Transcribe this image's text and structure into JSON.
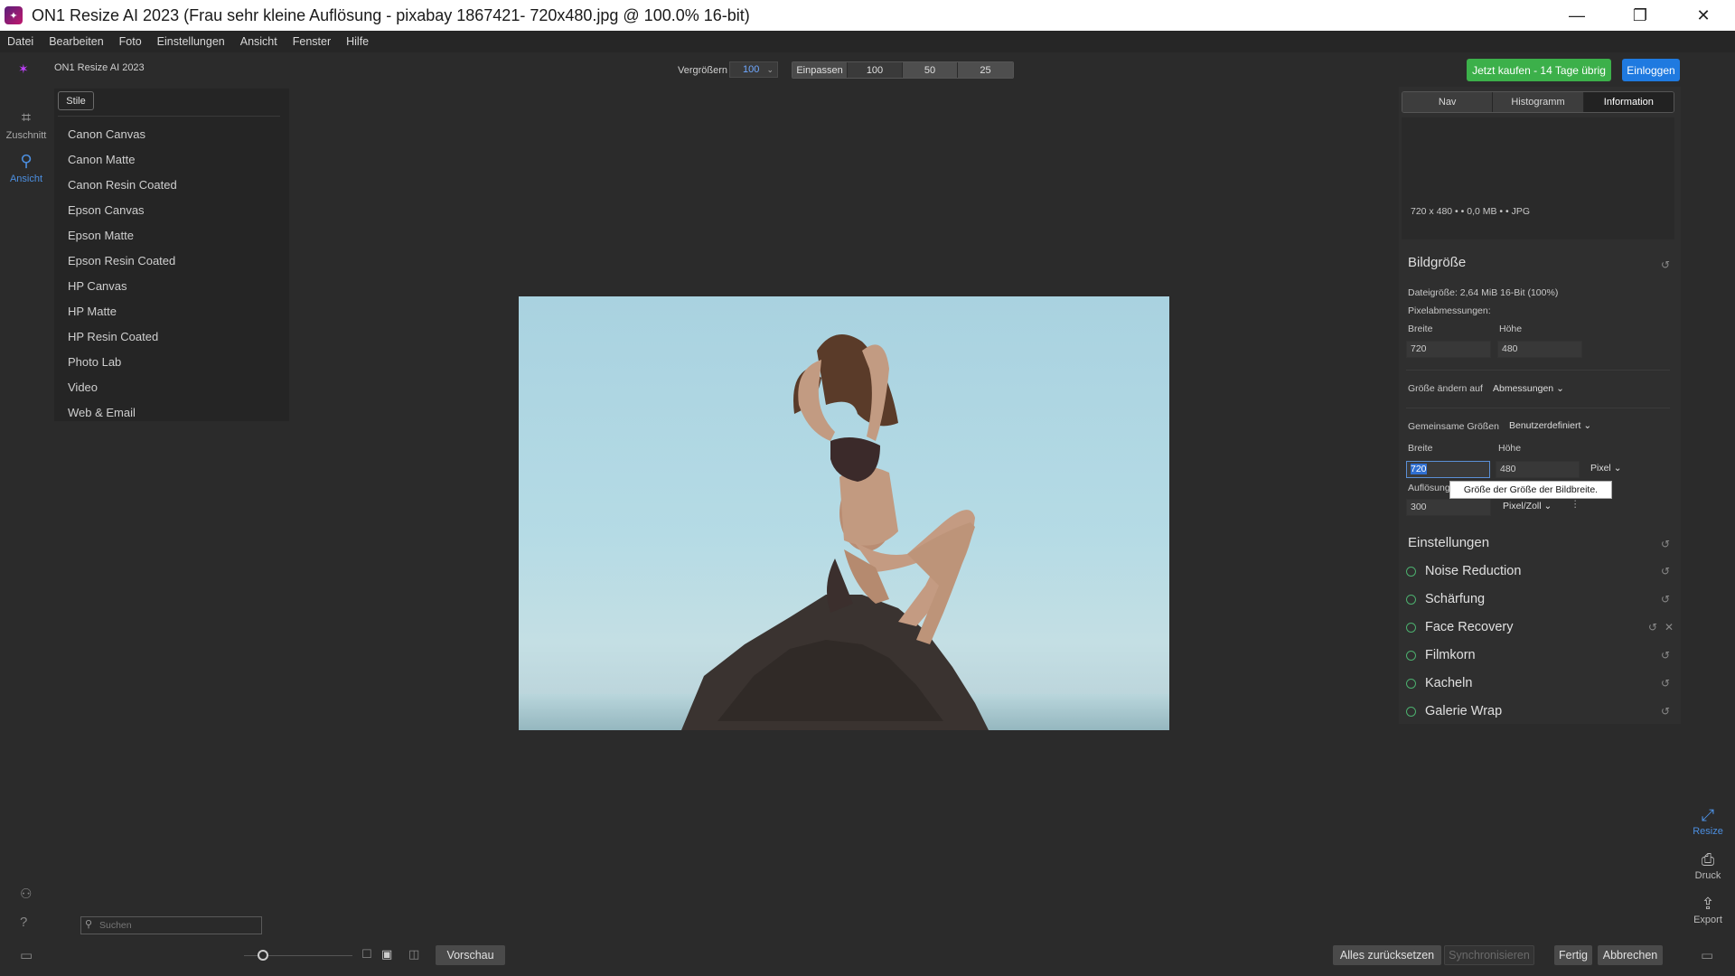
{
  "window": {
    "title": "ON1 Resize AI 2023 (Frau sehr kleine Auflösung - pixabay 1867421- 720x480.jpg @ 100.0% 16-bit)",
    "minimize": "—",
    "maximize": "❐",
    "close": "✕"
  },
  "menu": [
    "Datei",
    "Bearbeiten",
    "Foto",
    "Einstellungen",
    "Ansicht",
    "Fenster",
    "Hilfe"
  ],
  "toolbar": {
    "app_name": "ON1 Resize AI 2023",
    "zoom_label": "Vergrößern",
    "zoom_value": "100",
    "zoom_presets": [
      "Einpassen",
      "100",
      "50",
      "25"
    ],
    "buy_label": "Jetzt kaufen - 14 Tage übrig",
    "login_label": "Einloggen"
  },
  "left_rail": [
    {
      "label": "Zuschnitt",
      "icon": "crop-icon"
    },
    {
      "label": "Ansicht",
      "icon": "view-icon"
    }
  ],
  "styles": {
    "tab_label": "Stile",
    "items": [
      "Canon Canvas",
      "Canon Matte",
      "Canon Resin Coated",
      "Epson Canvas",
      "Epson Matte",
      "Epson Resin Coated",
      "HP Canvas",
      "HP Matte",
      "HP Resin Coated",
      "Photo Lab",
      "Video",
      "Web & Email"
    ]
  },
  "right_panel": {
    "tabs": [
      "Nav",
      "Histogramm",
      "Information"
    ],
    "active_tab": "Information",
    "info_line": "720 x 480 • • 0,0 MB • • JPG",
    "bildgroesse": {
      "title": "Bildgröße",
      "filesize": "Dateigröße: 2,64 MiB 16-Bit (100%)",
      "pixel_dims_label": "Pixelabmessungen:",
      "width_label": "Breite",
      "height_label": "Höhe",
      "orig_width": "720",
      "orig_height": "480",
      "resize_to_label": "Größe ändern auf",
      "resize_to_value": "Abmessungen",
      "common_sizes_label": "Gemeinsame Größen",
      "common_sizes_value": "Benutzerdefiniert",
      "new_width": "720",
      "new_height": "480",
      "unit": "Pixel",
      "resolution_label": "Auflösung",
      "resolution_value": "300",
      "resolution_unit": "Pixel/Zoll",
      "tooltip": "Größe der Größe der Bildbreite."
    },
    "einstellungen": {
      "title": "Einstellungen",
      "items": [
        "Noise Reduction",
        "Schärfung",
        "Face Recovery",
        "Filmkorn",
        "Kacheln",
        "Galerie Wrap"
      ]
    }
  },
  "right_rail": [
    {
      "label": "Resize",
      "icon": "resize-icon"
    },
    {
      "label": "Druck",
      "icon": "print-icon"
    },
    {
      "label": "Export",
      "icon": "export-icon"
    }
  ],
  "bottom": {
    "search_placeholder": "Suchen",
    "preview_label": "Vorschau",
    "reset_all_label": "Alles zurücksetzen",
    "sync_label": "Synchronisieren",
    "done_label": "Fertig",
    "cancel_label": "Abbrechen"
  },
  "colors": {
    "accent_blue": "#1f7ae0",
    "buy_green": "#3cb04a",
    "background": "#2b2b2b"
  }
}
